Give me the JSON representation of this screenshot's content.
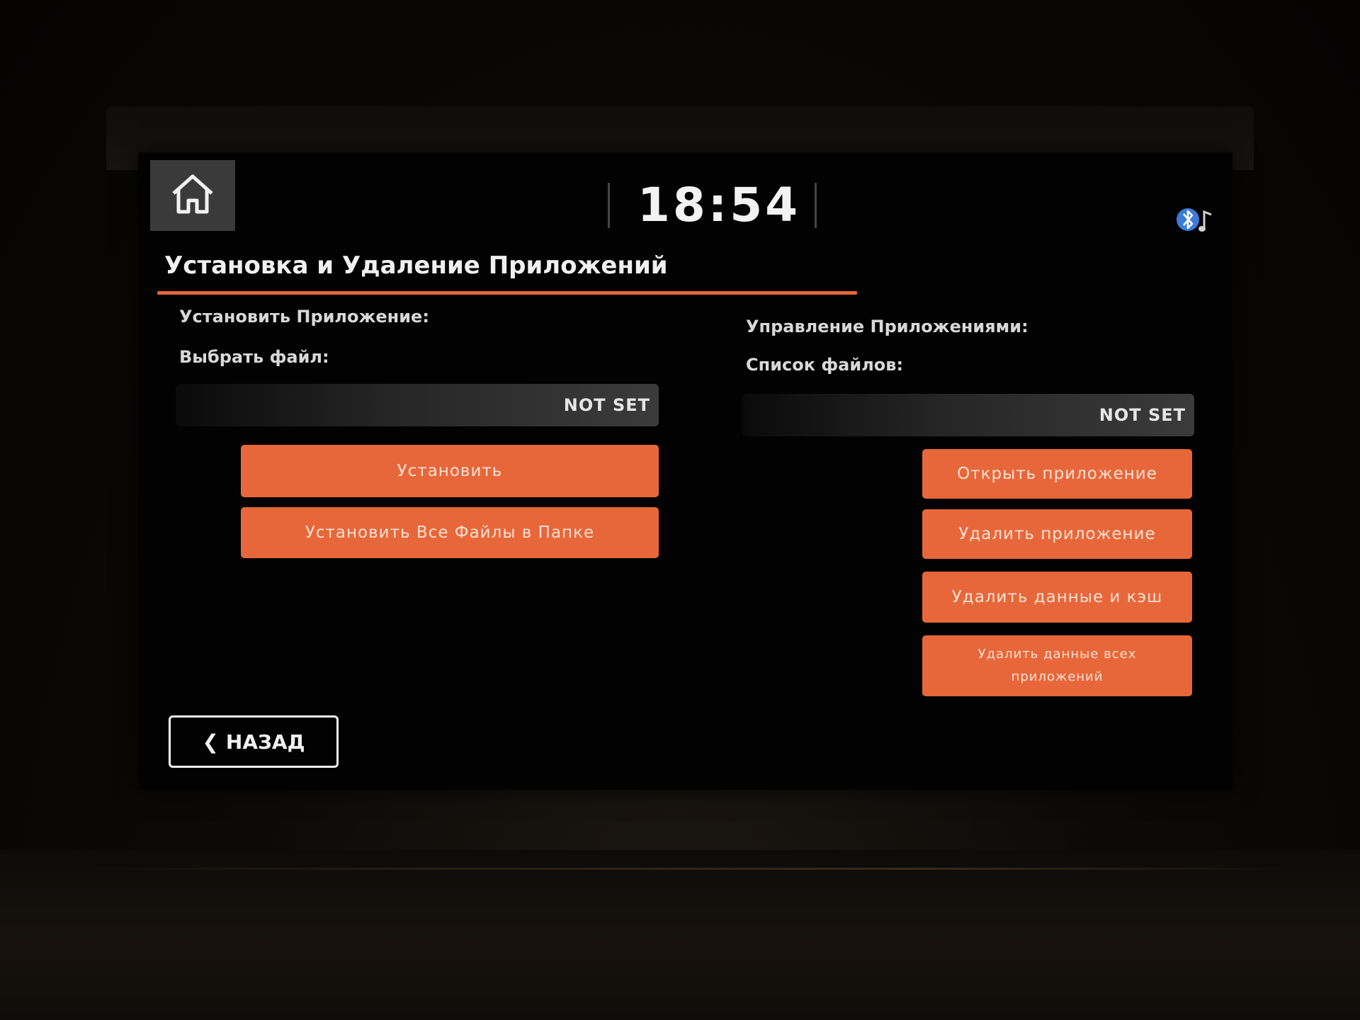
{
  "status_bar": {
    "time": "18:54",
    "home_icon": "home-icon",
    "bluetooth_audio_icon": "bluetooth-audio-icon"
  },
  "page": {
    "title": "Установка и Удаление Приложений"
  },
  "install": {
    "section_label": "Установить Приложение:",
    "file_label": "Выбрать файл:",
    "file_value": "NOT SET",
    "install_button": "Установить",
    "install_all_button": "Установить Все Файлы в Папке"
  },
  "manage": {
    "section_label": "Управление Приложениями:",
    "file_list_label": "Список файлов:",
    "file_list_value": "NOT SET",
    "open_button": "Открыть приложение",
    "delete_button": "Удалить приложение",
    "clear_data_button": "Удалить данные и кэш",
    "clear_all_data_button": "Удалить данные всех приложений"
  },
  "back": {
    "label": "НАЗАД",
    "chevron_icon": "chevron-left-icon"
  },
  "colors": {
    "accent": "#e8673a",
    "screen_bg": "#020202",
    "text": "#f0f0f0"
  }
}
